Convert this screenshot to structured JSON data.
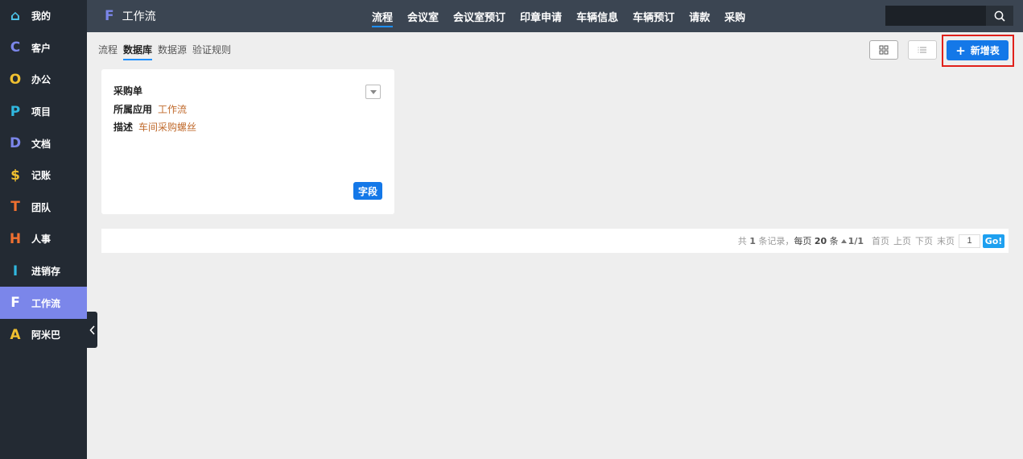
{
  "sidebar": {
    "items": [
      {
        "label": "我的",
        "icon": "home-icon",
        "glyph": "⌂",
        "color": "#4dc3e8"
      },
      {
        "label": "客户",
        "icon": "letter-c-icon",
        "glyph": "C",
        "color": "#7b86ea"
      },
      {
        "label": "办公",
        "icon": "letter-o-icon",
        "glyph": "O",
        "color": "#f0c030"
      },
      {
        "label": "项目",
        "icon": "letter-p-icon",
        "glyph": "P",
        "color": "#30b8e0"
      },
      {
        "label": "文档",
        "icon": "letter-d-icon",
        "glyph": "D",
        "color": "#7b86ea"
      },
      {
        "label": "记账",
        "icon": "dollar-icon",
        "glyph": "$",
        "color": "#f0c030"
      },
      {
        "label": "团队",
        "icon": "letter-t-icon",
        "glyph": "T",
        "color": "#f07030"
      },
      {
        "label": "人事",
        "icon": "letter-h-icon",
        "glyph": "H",
        "color": "#f07030"
      },
      {
        "label": "进销存",
        "icon": "letter-i-icon",
        "glyph": "I",
        "color": "#30b8e0"
      },
      {
        "label": "工作流",
        "icon": "letter-f-icon",
        "glyph": "F",
        "color": "#ffffff",
        "active": true
      },
      {
        "label": "阿米巴",
        "icon": "letter-a-icon",
        "glyph": "A",
        "color": "#f0c030"
      }
    ]
  },
  "header": {
    "logo_glyph": "F",
    "title": "工作流",
    "nav": [
      "流程",
      "会议室",
      "会议室预订",
      "印章申请",
      "车辆信息",
      "车辆预订",
      "请款",
      "采购"
    ],
    "search_value": ""
  },
  "subtabs": [
    "流程",
    "数据库",
    "数据源",
    "验证规则"
  ],
  "toolbar": {
    "new_plus": "+",
    "new_label": "新增表"
  },
  "card": {
    "title": "采购单",
    "app_label": "所属应用",
    "app_value": "工作流",
    "desc_label": "描述",
    "desc_value": "车间采购螺丝",
    "field_button": "字段"
  },
  "pager": {
    "total_prefix": "共",
    "total": "1",
    "total_suffix": "条记录，",
    "per_prefix": "每页",
    "per": "20",
    "per_suffix": "条",
    "page": "1/1",
    "first": "首页",
    "prev": "上页",
    "next": "下页",
    "last": "末页",
    "input": "1",
    "go": "Go!"
  },
  "colors": {
    "accent": "#1478e8",
    "active_sidebar": "#7b86ea",
    "highlight_box": "#e0201a"
  }
}
